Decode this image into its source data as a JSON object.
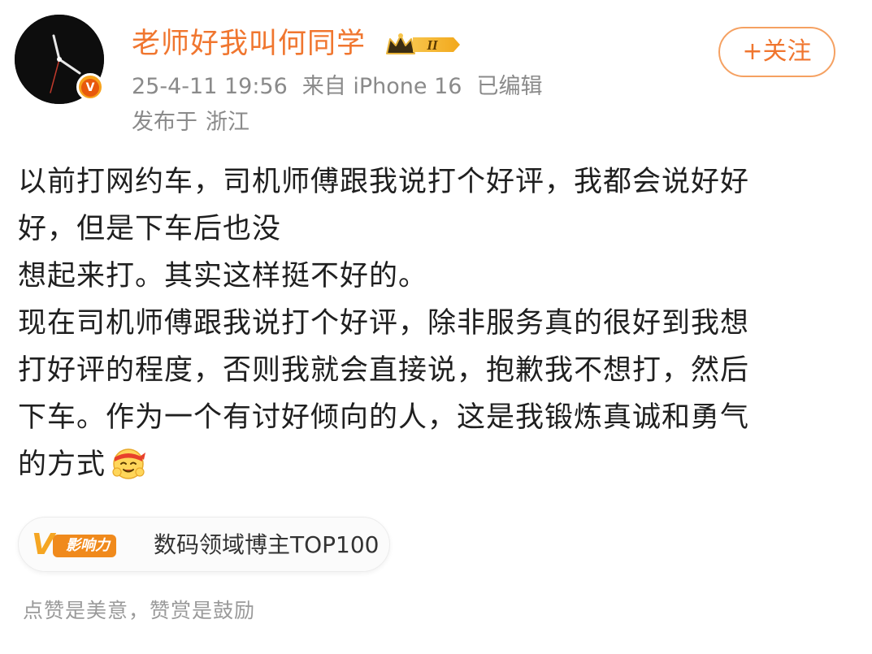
{
  "author": {
    "name": "老师好我叫何同学",
    "level_badge": "II",
    "avatar_icon": "clock-hands-avatar",
    "verified_badge": "V"
  },
  "meta": {
    "timestamp": "25-4-11 19:56",
    "source": "来自 iPhone 16",
    "edited": "已编辑"
  },
  "location": {
    "prefix": "发布于",
    "place": "浙江"
  },
  "follow_button": {
    "label": "+关注"
  },
  "post": {
    "lines": [
      "以前打网约车，司机师傅跟我说打个好评，我都会说好好",
      "好，但是下车后也没",
      "想起来打。其实这样挺不好的。",
      "现在司机师傅跟我说打个好评，除非服务真的很好到我想",
      "打好评的程度，否则我就会直接说，抱歉我不想打，然后",
      "下车。作为一个有讨好倾向的人，这是我锻炼真诚和勇气",
      "的方式"
    ],
    "trailing_emoji": "fighting-face-emoji"
  },
  "influence": {
    "logo_mark": "V",
    "logo_label": "影响力",
    "text": "数码领域博主TOP100"
  },
  "footer": {
    "note": "点赞是美意，赞赏是鼓励"
  },
  "colors": {
    "accent": "#f0762f",
    "follow_border": "#f5a162",
    "meta_gray": "#8a8a8a",
    "badge_orange": "#f08a1c",
    "badge_gold": "#f5a623"
  }
}
